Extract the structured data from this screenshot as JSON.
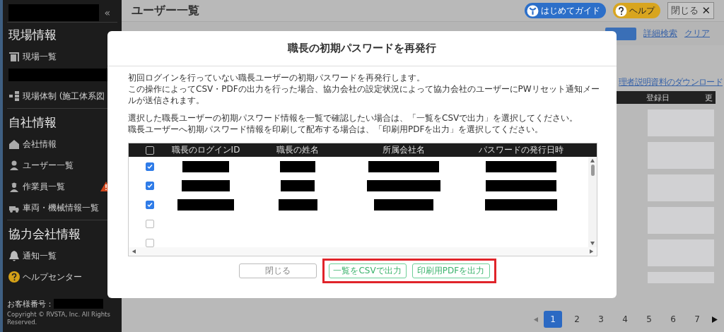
{
  "sidebar": {
    "collapse_icon": "«",
    "sections": [
      {
        "heading": "現場情報",
        "items": [
          {
            "label": "現場一覧"
          },
          {
            "kind": "redacted"
          },
          {
            "label": "現場体制 (施工体系図"
          }
        ]
      },
      {
        "heading": "自社情報",
        "items": [
          {
            "label": "会社情報"
          },
          {
            "label": "ユーザー一覧"
          },
          {
            "label": "作業員一覧",
            "warning": true
          },
          {
            "label": "車両・機械情報一覧"
          }
        ]
      },
      {
        "heading": "協力会社情報",
        "items": [
          {
            "label": "通知一覧"
          },
          {
            "label": "ヘルプセンター"
          }
        ]
      }
    ],
    "customer_label": "お客様番号：",
    "copyright": "Copyright © RVSTA, Inc. All Rights Reserved."
  },
  "page": {
    "title": "ユーザー一覧",
    "guide_button": "はじめてガイド",
    "help_button": "ヘルプ",
    "close_button": "閉じる",
    "close_icon": "✕",
    "links": [
      "詳細検索",
      "クリア"
    ],
    "download_link": "理者説明資料のダウンロード",
    "table": {
      "columns": [
        "登録日",
        "更"
      ]
    },
    "pagination": {
      "pages": [
        {
          "label": "1",
          "selected": true
        },
        {
          "label": "2",
          "selected": false
        },
        {
          "label": "3",
          "selected": false
        },
        {
          "label": "4",
          "selected": false
        },
        {
          "label": "5",
          "selected": false
        },
        {
          "label": "6",
          "selected": false
        },
        {
          "label": "7",
          "selected": false
        }
      ]
    }
  },
  "dialog": {
    "title": "職長の初期パスワードを再発行",
    "paragraphs": [
      [
        "初回ログインを行っていない職長ユーザーの初期パスワードを再発行します。",
        "この操作によってCSV・PDFの出力を行った場合、協力会社の設定状況によって協力会社のユーザーにPWリセット通知メールが送信されます。"
      ],
      [
        "選択した職長ユーザーの初期パスワード情報を一覧で確認したい場合は、「一覧をCSVで出力」を選択してください。",
        "職長ユーザーへ初期パスワード情報を印刷して配布する場合は、「印刷用PDFを出力」を選択してください。"
      ]
    ],
    "table": {
      "select_all_checked": false,
      "columns": [
        "職長のログインID",
        "職長の姓名",
        "所属会社名",
        "パスワードの発行日時"
      ],
      "rows": [
        {
          "checked": true,
          "redacted": true
        },
        {
          "checked": true,
          "redacted": true
        },
        {
          "checked": true,
          "redacted": true
        },
        {
          "checked": false,
          "redacted": false
        },
        {
          "checked": false,
          "redacted": false
        }
      ]
    },
    "buttons": [
      {
        "label": "閉じる",
        "kind": "cancel"
      },
      {
        "label": "一覧をCSVで出力",
        "kind": "export"
      },
      {
        "label": "印刷用PDFを出力",
        "kind": "export"
      }
    ]
  }
}
